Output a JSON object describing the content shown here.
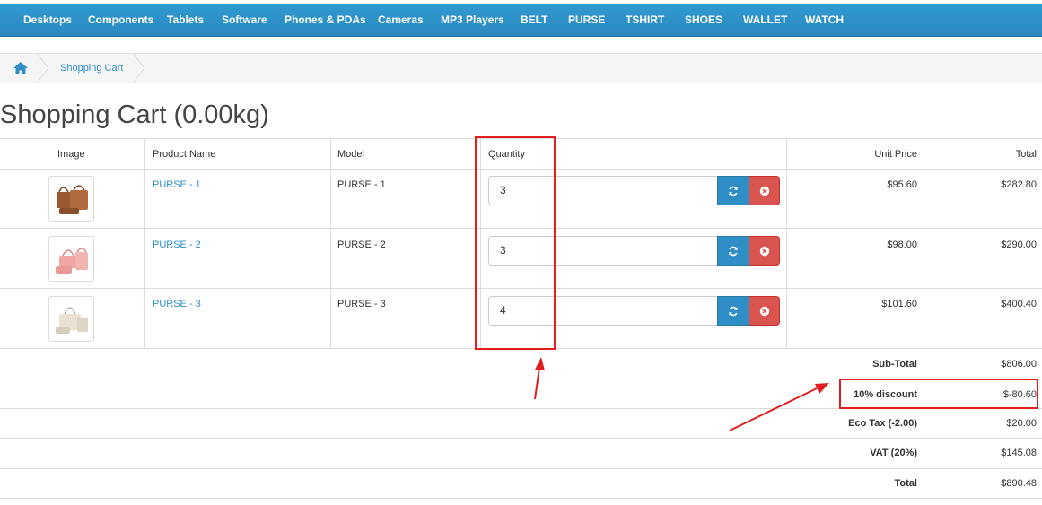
{
  "nav": {
    "items": [
      "Desktops",
      "Components",
      "Tablets",
      "Software",
      "Phones & PDAs",
      "Cameras",
      "MP3 Players",
      "BELT",
      "PURSE",
      "TSHIRT",
      "SHOES",
      "WALLET",
      "WATCH"
    ]
  },
  "breadcrumb": {
    "home_icon": "home-icon",
    "current": "Shopping Cart"
  },
  "page": {
    "title": "Shopping Cart (0.00kg)"
  },
  "cart": {
    "headers": {
      "image": "Image",
      "product": "Product Name",
      "model": "Model",
      "quantity": "Quantity",
      "unit_price": "Unit Price",
      "total": "Total"
    },
    "rows": [
      {
        "name": "PURSE - 1",
        "model": "PURSE - 1",
        "quantity": "3",
        "unit_price": "$95.60",
        "total": "$282.80"
      },
      {
        "name": "PURSE - 2",
        "model": "PURSE - 2",
        "quantity": "3",
        "unit_price": "$98.00",
        "total": "$290.00"
      },
      {
        "name": "PURSE - 3",
        "model": "PURSE - 3",
        "quantity": "4",
        "unit_price": "$101.60",
        "total": "$400.40"
      }
    ],
    "update_icon": "refresh-icon",
    "remove_icon": "remove-circle-icon"
  },
  "totals": [
    {
      "label": "Sub-Total",
      "value": "$806.00"
    },
    {
      "label": "10% discount",
      "value": "$-80.60"
    },
    {
      "label": "Eco Tax (-2.00)",
      "value": "$20.00"
    },
    {
      "label": "VAT (20%)",
      "value": "$145.08"
    },
    {
      "label": "Total",
      "value": "$890.48"
    }
  ],
  "colors": {
    "nav_bg": "#2b90c9",
    "link": "#2f8ec6",
    "update_button": "#2f8ec6",
    "remove_button": "#d9534f",
    "annotation": "#e01e1e"
  }
}
